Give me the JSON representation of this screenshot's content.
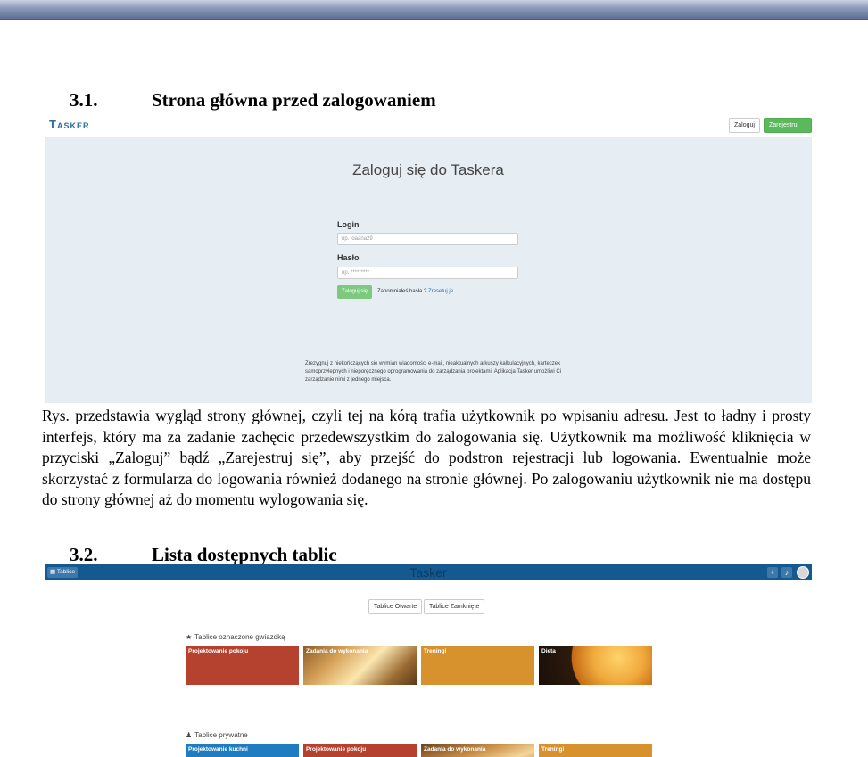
{
  "section1": {
    "number": "3.1.",
    "title": "Strona główna przed zalogowaniem"
  },
  "shot1": {
    "logo": "Tasker",
    "login_button": "Zaloguj",
    "register_button": "Zarejestruj się",
    "form_title": "Zaloguj się do Taskera",
    "login_label": "Login",
    "login_placeholder": "np. joaana29",
    "password_label": "Hasło",
    "password_placeholder": "np. *********",
    "submit_label": "Zaloguj się",
    "forgot_text": "Zapomniałeś hasła ?",
    "forgot_link": "Zresetuj je.",
    "footer_text": "Zrezygnuj z niekończących się wymian wiadomości e-mail, nieaktualnych arkuszy kalkulacyjnych, karteczek samoprzylepnych i nieporęcznego oprogramowania do zarządzania projektami. Aplikacja Tasker umożliwi Ci zarządzanie nimi z jednego miejsca."
  },
  "paragraph": "Rys. przedstawia wygląd strony głównej, czyli tej na kórą trafia użytkownik po wpisaniu adresu. Jest to ładny i prosty interfejs, który ma za zadanie zachęcic przedewszystkim do zalogowania się. Użytkownik ma możliwość kliknięcia w przyciski „Zaloguj” bądź „Zarejestruj się”, aby przejść do podstron rejestracji lub logowania. Ewentualnie może skorzystać z formularza do logowania również dodanego na stronie głównej. Po zalogowaniu użytkownik nie ma dostępu do strony głównej aż do momentu wylogowania się.",
  "section2": {
    "number": "3.2.",
    "title": "Lista dostępnych tablic"
  },
  "shot2": {
    "nav_tab": "Tablice",
    "brand": "Tasker",
    "icons": [
      "plus-icon",
      "bell-icon",
      "avatar"
    ],
    "open_button": "Tablice Otwarte",
    "closed_button": "Tablice Zamknięte",
    "starred_heading": "Tablice oznaczone gwiazdką",
    "starred_boards": [
      {
        "label": "Projektowanie pokoju",
        "color": "#b5412f"
      },
      {
        "label": "Zadania do wykonania",
        "color": "image"
      },
      {
        "label": "Treningi",
        "color": "#d7922e"
      },
      {
        "label": "Dieta",
        "color": "image"
      }
    ],
    "private_heading": "Tablice prywatne",
    "private_boards": [
      {
        "label": "Projektowanie kuchni",
        "color": "#1f7cc1"
      },
      {
        "label": "Projektowanie pokoju",
        "color": "#b5412f"
      },
      {
        "label": "Zadania do wykonania",
        "color": "image"
      },
      {
        "label": "Treningi",
        "color": "#d7922e"
      }
    ]
  }
}
